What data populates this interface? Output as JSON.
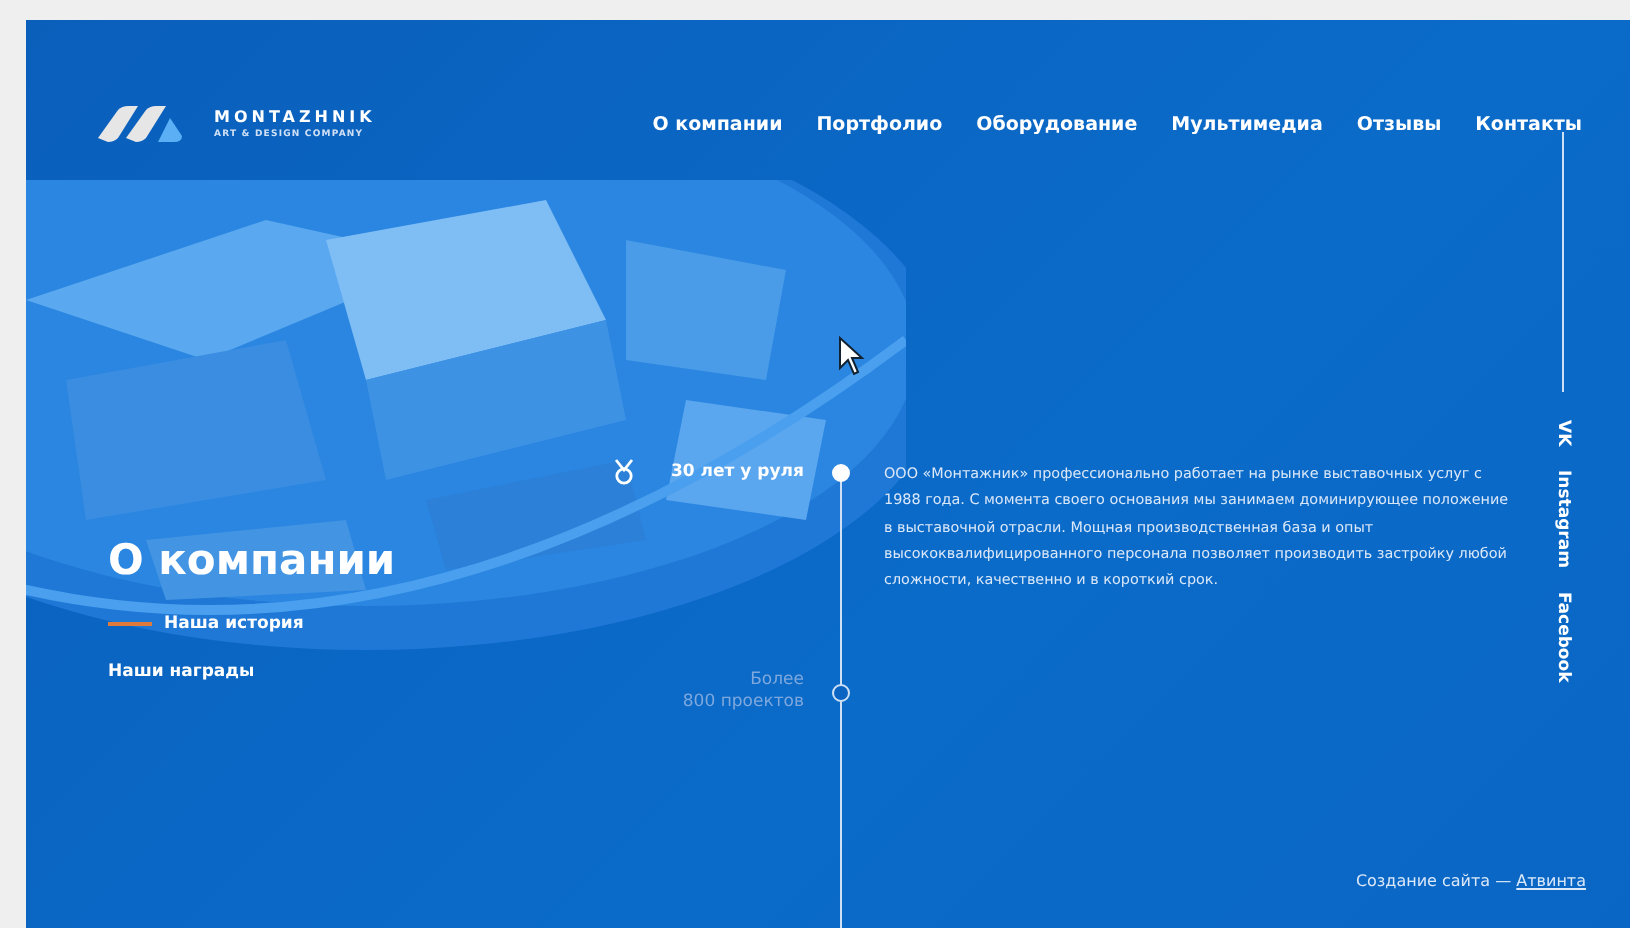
{
  "logo": {
    "name": "MONTAZHNIK",
    "tagline": "ART & DESIGN COMPANY"
  },
  "nav": [
    "О компании",
    "Портфолио",
    "Оборудование",
    "Мультимедиа",
    "Отзывы",
    "Контакты"
  ],
  "page_title": "О компании",
  "subnav": [
    {
      "label": "Наша история",
      "selected": true
    },
    {
      "label": "Наши награды",
      "selected": false
    }
  ],
  "timeline": [
    {
      "kind": "award",
      "lines": [
        "30 лет у руля"
      ],
      "selected": true
    },
    {
      "kind": "plain",
      "lines": [
        "Более",
        "800 проектов"
      ],
      "selected": false
    }
  ],
  "description": "ООО «Монтажник»  профессионально работает на рынке выставочных услуг с 1988 года. С момента своего основания мы занимаем доминирующее положение в выставочной отрасли. Мощная производственная база и опыт высококвалифицированного персонала позволяет производить застройку любой сложности, качественно и в короткий срок.",
  "social": [
    "VK",
    "Instagram",
    "Facebook"
  ],
  "credit": {
    "text": "Создание сайта —",
    "link": "Атвинта"
  }
}
